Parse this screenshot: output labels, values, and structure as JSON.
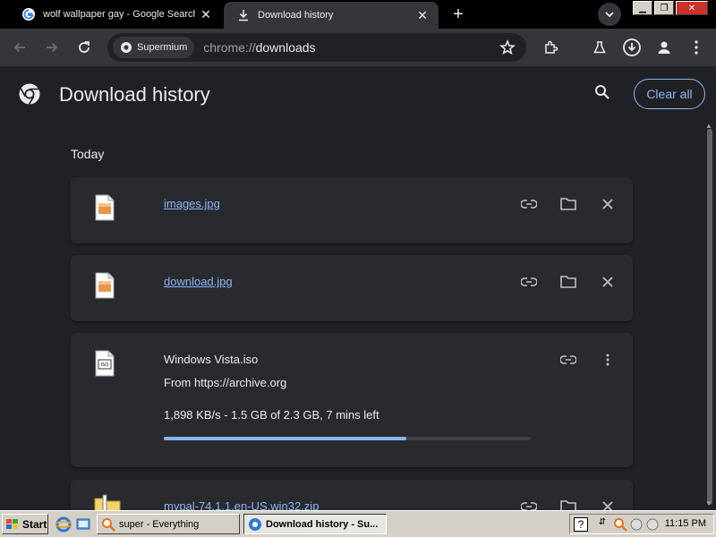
{
  "tabs": [
    {
      "title": "wolf wallpaper gay - Google Search",
      "favicon": "google-icon",
      "active": false
    },
    {
      "title": "Download history",
      "favicon": "download-icon",
      "active": true
    }
  ],
  "toolbar": {
    "chip_label": "Supermium",
    "url_prefix": "chrome://",
    "url_path": "downloads"
  },
  "page": {
    "title": "Download history",
    "clear_all": "Clear all",
    "section": "Today"
  },
  "downloads": [
    {
      "name": "images.jpg",
      "type": "image"
    },
    {
      "name": "download.jpg",
      "type": "image"
    },
    {
      "name": "Windows Vista.iso",
      "type": "iso",
      "from": "From https://archive.org",
      "status": "1,898 KB/s - 1.5 GB of 2.3 GB, 7 mins left",
      "progress": 0.66
    },
    {
      "name": "mypal-74.1.1.en-US.win32.zip",
      "type": "zip"
    }
  ],
  "taskbar": {
    "start": "Start",
    "items": [
      "super - Everything",
      "Download history - Su..."
    ],
    "clock": "11:15 PM"
  },
  "colors": {
    "accent": "#8ab4f8",
    "page_bg": "#202124",
    "card_bg": "#292a2d"
  }
}
